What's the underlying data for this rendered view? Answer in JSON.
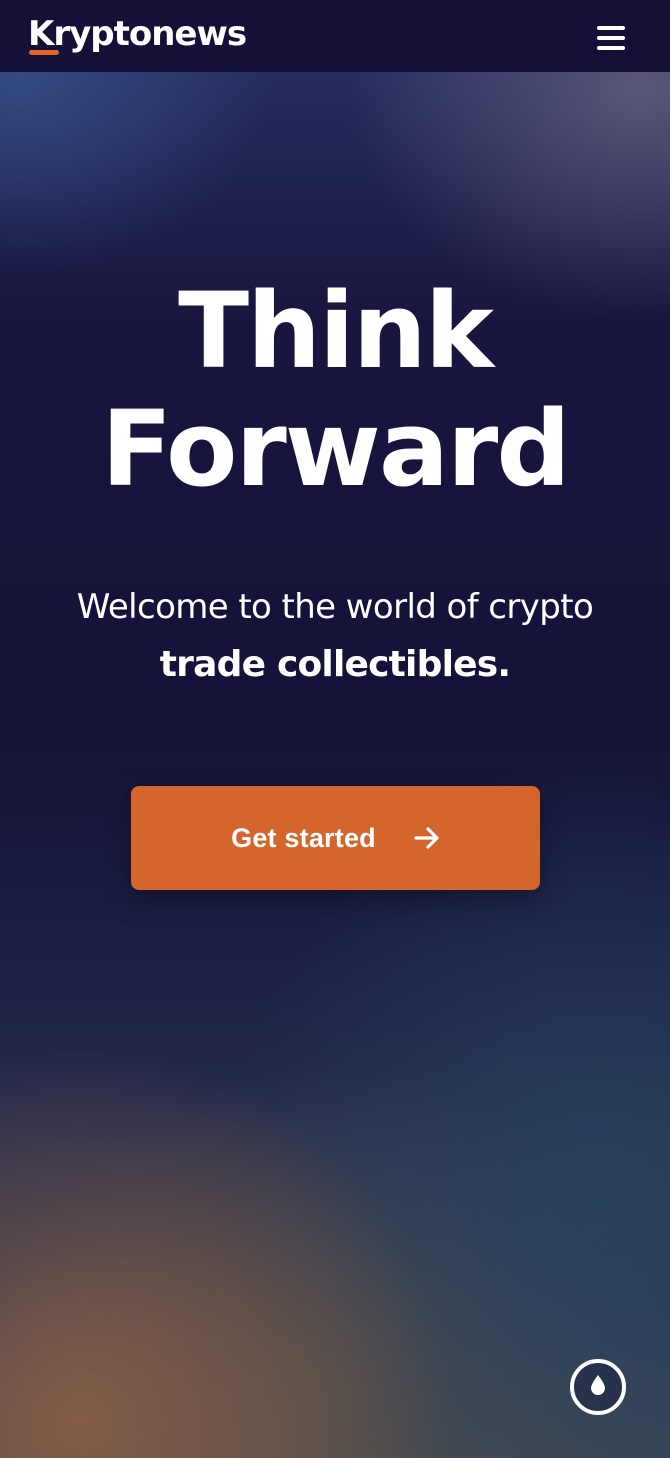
{
  "header": {
    "logo_text": "Kryptonews",
    "menu_icon": "hamburger-menu-icon"
  },
  "hero": {
    "title_line1": "Think",
    "title_line2": "Forward",
    "subtitle_line1": "Welcome to the world of crypto",
    "subtitle_line2": "trade collectibles."
  },
  "cta": {
    "label": "Get started",
    "icon": "arrow-right-icon"
  },
  "theme_toggle": {
    "icon": "droplet-icon"
  },
  "colors": {
    "header_bg": "#141037",
    "accent": "#d4652c",
    "text": "#ffffff"
  }
}
